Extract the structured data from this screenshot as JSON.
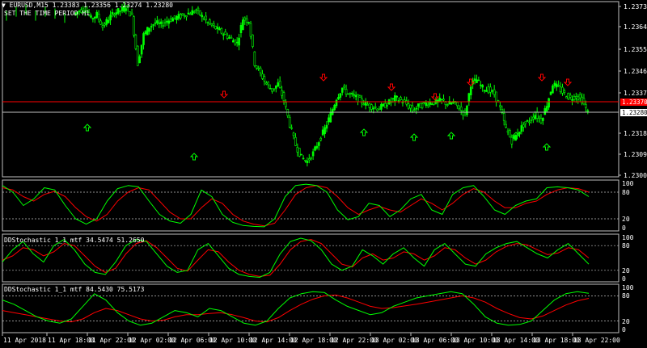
{
  "header": {
    "symbol_line": "EURUSD,M15  1.23383 1.23356 1.23274 1.23280",
    "subtitle": "SET THE TIME PERIOD H1"
  },
  "colors": {
    "background": "#000000",
    "frame": "#c0c0c0",
    "candles": "#00ff00",
    "main_line": "#00ff00",
    "signal_line": "#ff0000",
    "arrow_up": "#00ff00",
    "arrow_down": "#ff0000",
    "current_price_bg": "#ff0000",
    "bid_line": "#c0c0c0",
    "red_line": "#ff0000"
  },
  "price_axis": {
    "labels": [
      "1.23735",
      "1.23645",
      "1.23555",
      "1.23460",
      "1.23370",
      "1.23185",
      "1.23095",
      "1.23005"
    ],
    "current_price_tag": "1.23370",
    "bid_price_tag": "1.23280"
  },
  "time_axis": {
    "labels": [
      "11 Apr 2018",
      "11 Apr 18:00",
      "11 Apr 22:00",
      "12 Apr 02:00",
      "12 Apr 06:00",
      "12 Apr 10:00",
      "12 Apr 14:00",
      "12 Apr 18:00",
      "12 Apr 22:00",
      "13 Apr 02:00",
      "13 Apr 06:00",
      "13 Apr 10:00",
      "13 Apr 14:00",
      "13 Apr 18:00",
      "13 Apr 22:00"
    ]
  },
  "indicators": [
    {
      "title": "",
      "scale": [
        "100",
        "80",
        "20",
        "0"
      ]
    },
    {
      "title": "DDStochastic 1_1 mtf 34.5474 51.2650",
      "scale": [
        "100",
        "80",
        "20",
        "0"
      ]
    },
    {
      "title": "DDStochastic 1_1 mtf 84.5430 75.5173",
      "scale": [
        "100",
        "80",
        "20",
        "0"
      ]
    }
  ],
  "chart_data": {
    "type": "candlestick",
    "ylim": [
      1.2296,
      1.2378
    ],
    "close_path": [
      1.2374,
      1.2376,
      1.2377,
      1.2372,
      1.2374,
      1.2368,
      1.2372,
      1.2375,
      1.2376,
      1.2378,
      1.2373,
      1.235,
      1.2364,
      1.2368,
      1.237,
      1.2369,
      1.2371,
      1.2372,
      1.2373,
      1.2374,
      1.2375,
      1.2376,
      1.2373,
      1.237,
      1.2368,
      1.2366,
      1.2364,
      1.2362,
      1.236,
      1.2372,
      1.2371,
      1.235,
      1.2345,
      1.234,
      1.2337,
      1.234,
      1.2332,
      1.232,
      1.231,
      1.2304,
      1.2302,
      1.2306,
      1.2312,
      1.2318,
      1.2325,
      1.2333,
      1.2338,
      1.2335,
      1.2334,
      1.2332,
      1.233,
      1.2329,
      1.2328,
      1.2329,
      1.2331,
      1.2333,
      1.2332,
      1.233,
      1.2327,
      1.2329,
      1.233,
      1.2331,
      1.2331,
      1.2332,
      1.233,
      1.2331,
      1.2328,
      1.2325,
      1.234,
      1.2342,
      1.2338,
      1.2337,
      1.2335,
      1.2328,
      1.2318,
      1.2312,
      1.2316,
      1.232,
      1.2322,
      1.2325,
      1.2322,
      1.233,
      1.234,
      1.2338,
      1.2335,
      1.2333,
      1.2334,
      1.2332,
      1.2326
    ],
    "arrows_up_x": [
      108,
      240,
      450,
      512,
      558,
      638,
      676
    ],
    "arrows_down_x": [
      277,
      400,
      484,
      538,
      582,
      670,
      702
    ],
    "stoch_panels": [
      {
        "main": [
          95,
          80,
          50,
          65,
          90,
          85,
          50,
          20,
          8,
          20,
          60,
          88,
          95,
          92,
          60,
          30,
          15,
          10,
          30,
          85,
          70,
          30,
          12,
          5,
          3,
          2,
          20,
          70,
          95,
          98,
          95,
          80,
          40,
          18,
          25,
          55,
          50,
          25,
          40,
          65,
          75,
          40,
          30,
          75,
          90,
          95,
          70,
          40,
          30,
          50,
          60,
          65,
          90,
          92,
          90,
          85,
          70
        ],
        "signal": [
          90,
          85,
          70,
          60,
          75,
          82,
          70,
          45,
          25,
          15,
          30,
          60,
          80,
          90,
          85,
          60,
          35,
          20,
          20,
          45,
          65,
          55,
          30,
          15,
          8,
          4,
          10,
          40,
          75,
          90,
          95,
          90,
          70,
          45,
          30,
          40,
          48,
          40,
          35,
          50,
          65,
          55,
          40,
          55,
          75,
          88,
          80,
          60,
          45,
          45,
          55,
          60,
          75,
          85,
          90,
          88,
          80
        ]
      },
      {
        "main": [
          40,
          70,
          90,
          60,
          40,
          80,
          95,
          70,
          35,
          15,
          10,
          40,
          80,
          95,
          90,
          60,
          30,
          15,
          20,
          70,
          85,
          55,
          25,
          10,
          5,
          3,
          15,
          60,
          90,
          98,
          92,
          70,
          35,
          20,
          30,
          70,
          55,
          35,
          60,
          75,
          50,
          30,
          70,
          85,
          60,
          35,
          30,
          60,
          75,
          85,
          90,
          75,
          60,
          50,
          70,
          85,
          60,
          35
        ],
        "signal": [
          45,
          55,
          75,
          70,
          55,
          65,
          85,
          80,
          55,
          30,
          15,
          25,
          60,
          85,
          92,
          75,
          50,
          25,
          18,
          45,
          70,
          65,
          40,
          20,
          10,
          5,
          8,
          35,
          70,
          90,
          95,
          85,
          60,
          35,
          28,
          50,
          60,
          45,
          50,
          65,
          60,
          45,
          55,
          75,
          70,
          50,
          35,
          45,
          65,
          78,
          85,
          82,
          70,
          58,
          62,
          75,
          70,
          50
        ]
      },
      {
        "main": [
          70,
          60,
          45,
          30,
          20,
          15,
          25,
          55,
          85,
          70,
          40,
          20,
          10,
          15,
          30,
          45,
          40,
          30,
          50,
          45,
          30,
          15,
          10,
          20,
          50,
          75,
          85,
          90,
          88,
          70,
          55,
          45,
          35,
          40,
          55,
          65,
          75,
          80,
          85,
          90,
          85,
          60,
          30,
          15,
          10,
          12,
          20,
          45,
          70,
          85,
          90,
          86
        ],
        "signal": [
          45,
          40,
          35,
          30,
          25,
          20,
          18,
          25,
          40,
          50,
          45,
          35,
          25,
          20,
          22,
          30,
          35,
          35,
          38,
          40,
          35,
          28,
          20,
          18,
          28,
          45,
          60,
          72,
          80,
          82,
          75,
          65,
          55,
          50,
          52,
          56,
          60,
          65,
          70,
          75,
          80,
          75,
          65,
          50,
          38,
          28,
          25,
          32,
          45,
          58,
          68,
          74
        ]
      }
    ]
  }
}
